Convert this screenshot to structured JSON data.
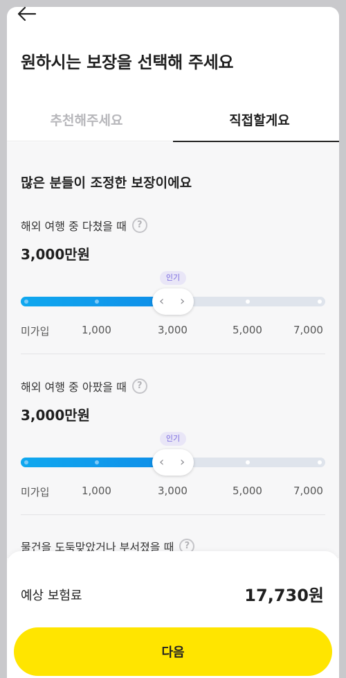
{
  "header": {
    "back_icon": "arrow-left-icon",
    "title": "원하시는 보장을 선택해 주세요"
  },
  "tabs": [
    {
      "label": "추천해주세요",
      "active": false
    },
    {
      "label": "직접할게요",
      "active": true
    }
  ],
  "main": {
    "section_title": "많은 분들이 조정한 보장이에요",
    "coverages": [
      {
        "label": "해외 여행 중 다쳤을 때",
        "help_icon": "question-icon",
        "help_glyph": "?",
        "value": "3,000만원",
        "badge": "인기",
        "slider_fraction": 0.5,
        "ticks": [
          "미가입",
          "1,000",
          "3,000",
          "5,000",
          "7,000"
        ]
      },
      {
        "label": "해외 여행 중 아팠을 때",
        "help_icon": "question-icon",
        "help_glyph": "?",
        "value": "3,000만원",
        "badge": "인기",
        "slider_fraction": 0.5,
        "ticks": [
          "미가입",
          "1,000",
          "3,000",
          "5,000",
          "7,000"
        ]
      },
      {
        "label": "물건을 도둑맞았거나 부서졌을 때",
        "help_icon": "question-icon",
        "help_glyph": "?"
      }
    ]
  },
  "footer": {
    "premium_label": "예상 보험료",
    "premium_value": "17,730원",
    "next_button": "다음"
  },
  "colors": {
    "accent_blue": "#0f8de8",
    "button_yellow": "#ffe500",
    "badge_purple": "#7a6be0"
  }
}
